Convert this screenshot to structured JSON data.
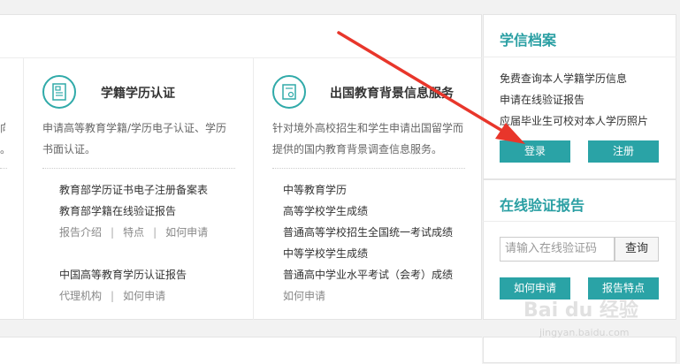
{
  "left_edge": {
    "line1": "向",
    "line2": "。"
  },
  "card_xueji": {
    "title": "学籍学历认证",
    "desc_line1": "申请高等教育学籍/学历电子认证、学历",
    "desc_line2": "书面认证。",
    "links": [
      "教育部学历证书电子注册备案表",
      "教育部学籍在线验证报告"
    ],
    "sub1": [
      "报告介绍",
      "特点",
      "如何申请"
    ],
    "link3": "中国高等教育学历认证报告",
    "sub2": [
      "代理机构",
      "如何申请"
    ]
  },
  "card_abroad": {
    "title": "出国教育背景信息服务",
    "desc_line1": "针对境外高校招生和学生申请出国留学而",
    "desc_line2": "提供的国内教育背景调查信息服务。",
    "links": [
      "中等教育学历",
      "高等学校学生成绩",
      "普通高等学校招生全国统一考试成绩",
      "中等学校学生成绩",
      "普通高中学业水平考试（会考）成绩",
      "如何申请"
    ]
  },
  "sidebar": {
    "archive_title": "学信档案",
    "archive_lines": [
      "免费查询本人学籍学历信息",
      "申请在线验证报告",
      "应届毕业生可校对本人学历照片"
    ],
    "login_label": "登录",
    "register_label": "注册",
    "verify_title": "在线验证报告",
    "verify_placeholder": "请输入在线验证码",
    "query_label": "查询",
    "how_apply_label": "如何申请",
    "report_features_label": "报告特点"
  },
  "watermark": {
    "brand": "Bai du 经验",
    "url": "jingyan.baidu.com"
  },
  "colors": {
    "accent": "#2aa3a6",
    "arrow": "#e8362b"
  },
  "icons": {
    "xueji": "certificate-icon",
    "abroad": "document-icon"
  }
}
